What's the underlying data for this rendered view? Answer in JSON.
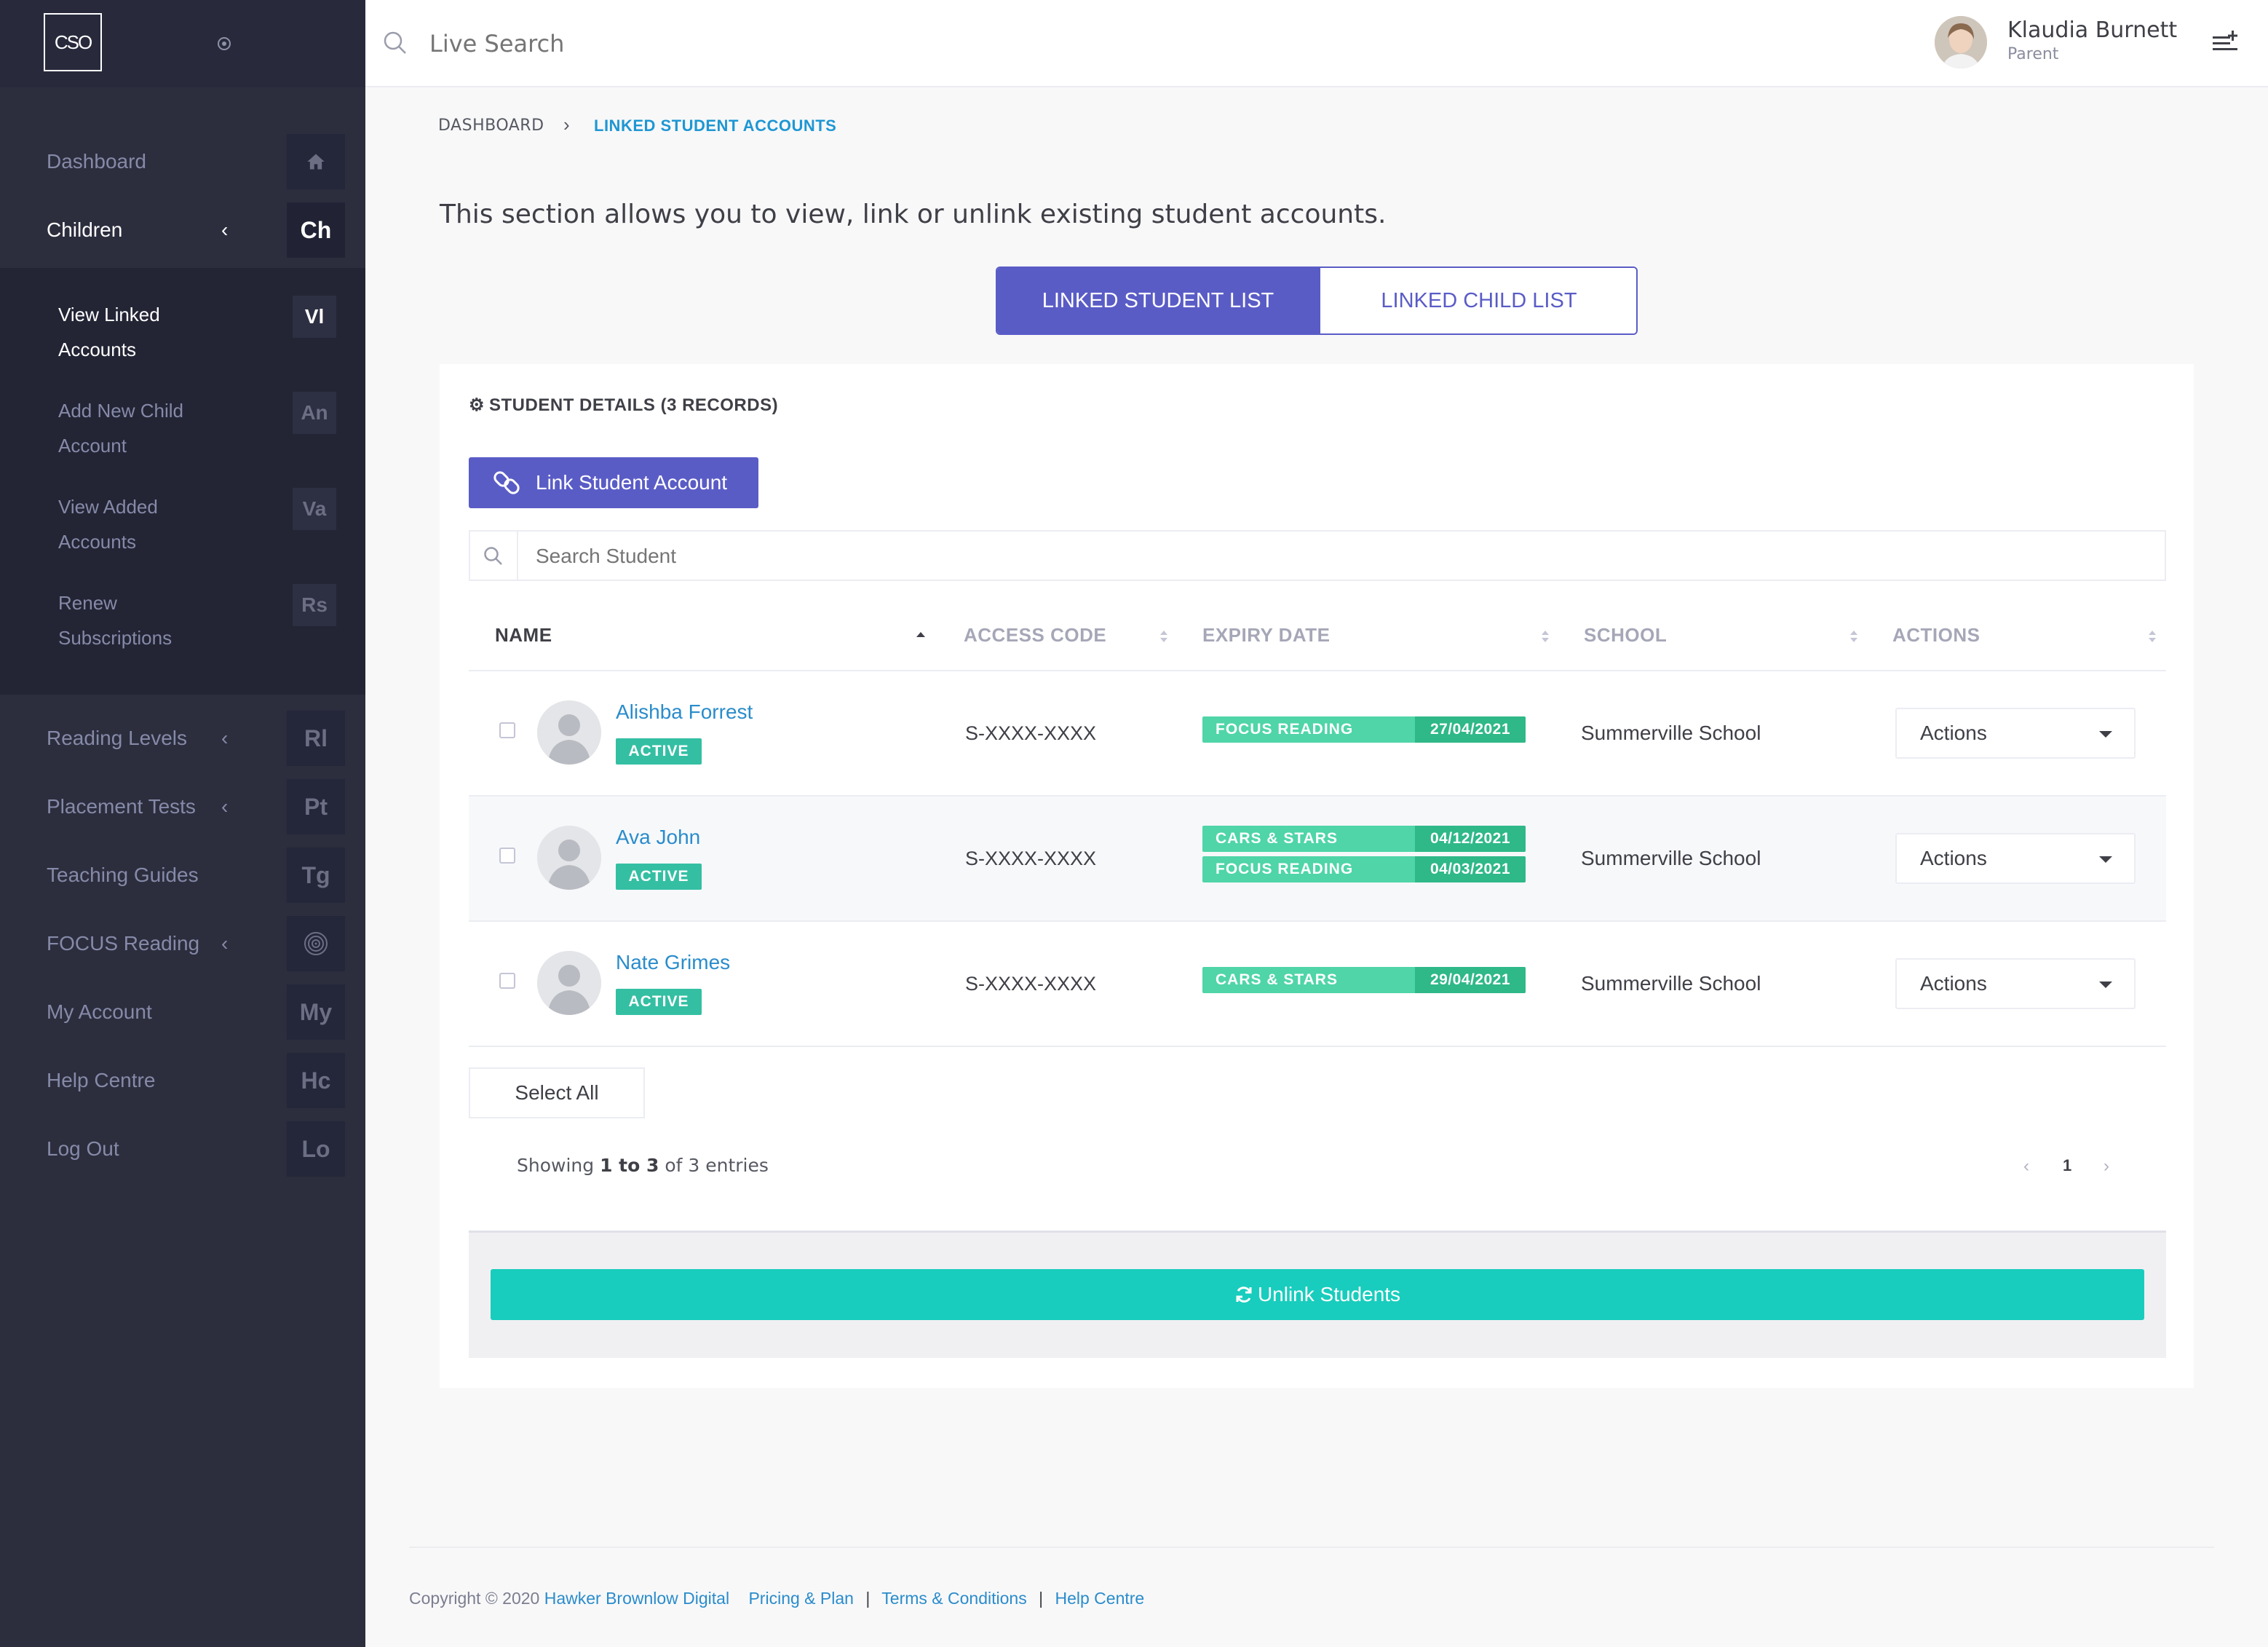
{
  "brand": {
    "logo_text": "CSO"
  },
  "sidebar": {
    "items": [
      {
        "label": "Dashboard",
        "abbr": "",
        "icon": "home-icon"
      },
      {
        "label": "Children",
        "abbr": "Ch"
      },
      {
        "label": "Reading Levels",
        "abbr": "Rl"
      },
      {
        "label": "Placement Tests",
        "abbr": "Pt"
      },
      {
        "label": "Teaching Guides",
        "abbr": "Tg"
      },
      {
        "label": "FOCUS Reading",
        "abbr": "",
        "icon": "target-icon"
      },
      {
        "label": "My Account",
        "abbr": "My"
      },
      {
        "label": "Help Centre",
        "abbr": "Hc"
      },
      {
        "label": "Log Out",
        "abbr": "Lo"
      }
    ],
    "submenu": [
      {
        "label": "View Linked Accounts",
        "abbr": "Vl"
      },
      {
        "label": "Add New Child Account",
        "abbr": "An"
      },
      {
        "label": "View Added Accounts",
        "abbr": "Va"
      },
      {
        "label": "Renew Subscriptions",
        "abbr": "Rs"
      }
    ]
  },
  "topbar": {
    "search_placeholder": "Live Search",
    "user_name": "Klaudia Burnett",
    "user_role": "Parent"
  },
  "breadcrumb": {
    "home": "DASHBOARD",
    "current": "LINKED STUDENT ACCOUNTS"
  },
  "intro": "This section allows you to view, link or unlink existing student accounts.",
  "tabs": [
    "LINKED STUDENT LIST",
    "LINKED CHILD LIST"
  ],
  "card": {
    "title": "STUDENT DETAILS (3 RECORDS)",
    "link_button": "Link Student Account",
    "search_placeholder": "Search Student",
    "columns": [
      "NAME",
      "ACCESS CODE",
      "EXPIRY DATE",
      "SCHOOL",
      "ACTIONS"
    ],
    "rows": [
      {
        "name": "Alishba Forrest",
        "status": "ACTIVE",
        "access_code": "S-XXXX-XXXX",
        "subscriptions": [
          {
            "name": "FOCUS READING",
            "date": "27/04/2021"
          }
        ],
        "school": "Summerville School",
        "action": "Actions"
      },
      {
        "name": "Ava John",
        "status": "ACTIVE",
        "access_code": "S-XXXX-XXXX",
        "subscriptions": [
          {
            "name": "CARS & STARS",
            "date": "04/12/2021"
          },
          {
            "name": "FOCUS READING",
            "date": "04/03/2021"
          }
        ],
        "school": "Summerville School",
        "action": "Actions"
      },
      {
        "name": "Nate Grimes",
        "status": "ACTIVE",
        "access_code": "S-XXXX-XXXX",
        "subscriptions": [
          {
            "name": "CARS & STARS",
            "date": "29/04/2021"
          }
        ],
        "school": "Summerville School",
        "action": "Actions"
      }
    ],
    "select_all": "Select All",
    "showing": {
      "prefix": "Showing",
      "range": "1 to 3",
      "suffix": "of 3 entries"
    },
    "pagination": {
      "prev": "‹",
      "current": "1",
      "next": "›"
    },
    "unlink_button": "Unlink Students"
  },
  "footer": {
    "copyright": "Copyright © 2020",
    "company": "Hawker Brownlow Digital",
    "links": [
      "Pricing & Plan",
      "Terms & Conditions",
      "Help Centre"
    ]
  },
  "colors": {
    "primary": "#5a5cc6",
    "accent_teal": "#18cdbd",
    "active_green": "#34bfa3",
    "link_blue": "#2a8ccb",
    "sidebar_bg": "#2c2e3e"
  }
}
